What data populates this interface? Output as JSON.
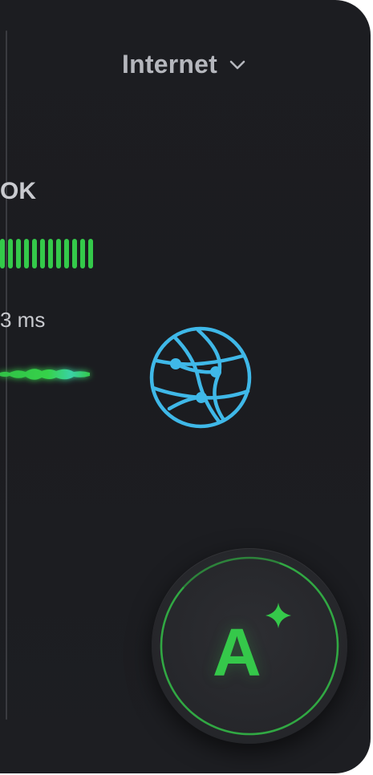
{
  "network": {
    "label": "Internet",
    "dropdown_icon": "chevron-down-icon"
  },
  "status": {
    "text": "OK"
  },
  "signal": {
    "bar_count": 12,
    "color": "#34c94a"
  },
  "latency": {
    "text": "3 ms"
  },
  "wave": {
    "icon": "waveform-icon",
    "color": "#34c94a"
  },
  "connection": {
    "icon": "globe-icon",
    "color": "#3fb8e8"
  },
  "rating": {
    "grade": "A",
    "icon": "sparkle-icon",
    "color": "#35c84a"
  }
}
